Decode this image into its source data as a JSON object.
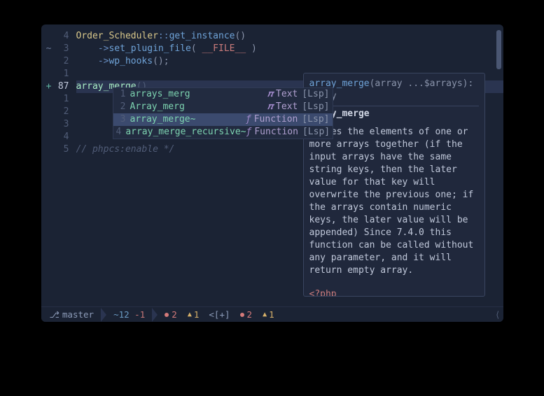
{
  "gutter": [
    {
      "sign": "",
      "num": "4"
    },
    {
      "sign": "~",
      "num": "3"
    },
    {
      "sign": "",
      "num": "2"
    },
    {
      "sign": "",
      "num": "1"
    },
    {
      "sign": "+",
      "num": "87",
      "current": true
    },
    {
      "sign": "",
      "num": "1"
    },
    {
      "sign": "",
      "num": "2"
    },
    {
      "sign": "",
      "num": "3"
    },
    {
      "sign": "",
      "num": "4"
    },
    {
      "sign": "",
      "num": "5"
    }
  ],
  "code": {
    "l0_class": "Order_Scheduler",
    "l0_op": "::",
    "l0_fn": "get_instance",
    "l0_paren": "()",
    "l1_arrow": "->",
    "l1_fn": "set_plugin_file",
    "l1_open": "( ",
    "l1_const": "__FILE__",
    "l1_close": " )",
    "l2_arrow": "->",
    "l2_fn": "wp_hooks",
    "l2_paren": "();",
    "cursor_typed": "array_merge",
    "cursor_ghost": "()",
    "comment": "// phpcs:enable */"
  },
  "completion": {
    "items": [
      {
        "idx": "1",
        "word": "arrays_merg",
        "icon": "𝝅",
        "kind": "Text",
        "src": "[Lsp]"
      },
      {
        "idx": "2",
        "word": "Array_merg",
        "icon": "𝝅",
        "kind": "Text",
        "src": "[Lsp]"
      },
      {
        "idx": "3",
        "word": "array_merge~",
        "icon": "ƒ",
        "kind": "Function",
        "src": "[Lsp]",
        "selected": true
      },
      {
        "idx": "4",
        "word": "array_merge_recursive~",
        "icon": "ƒ",
        "kind": "Function",
        "src": "[Lsp]"
      }
    ]
  },
  "doc": {
    "sig_fn": "array_merge",
    "sig_rest": "(array ...$arrays): array",
    "title": "array_merge",
    "body": "Merges the elements of one or more arrays together (if the input arrays have the same string keys, then the later value for that key will overwrite the previous one; if the arrays contain numeric keys, the later value will be appended) Since 7.4.0 this function can be called without any parameter, and it will return empty array.",
    "tag": "<?php"
  },
  "status": {
    "branch": "master",
    "diff_mod": "~12",
    "diff_del": "-1",
    "diag1_err": "2",
    "diag1_warn": "1",
    "brackets": "<[+]",
    "diag2_err": "2",
    "diag2_warn": "1"
  }
}
